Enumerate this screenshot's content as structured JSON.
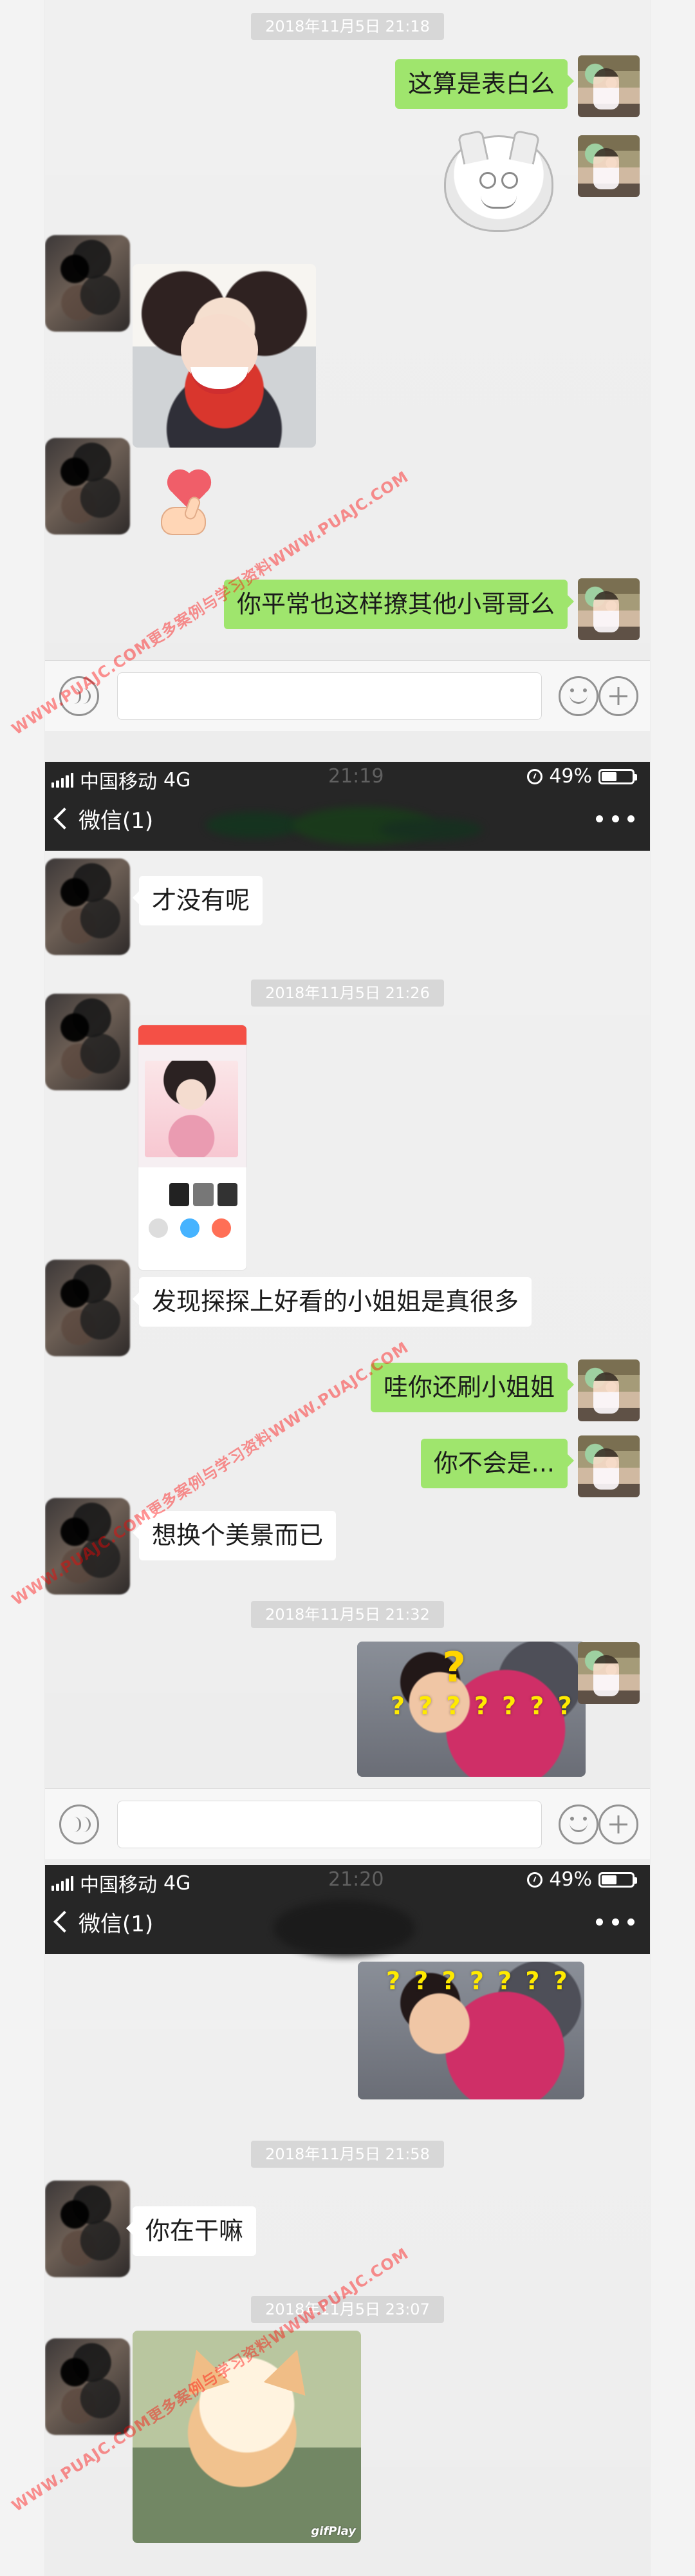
{
  "colors": {
    "accent_green": "#9fe56d",
    "nav_bg": "#262626",
    "chat_bg": "#ededed",
    "timestamp_bg": "#d7d7d7",
    "watermark_red": "rgba(255,0,0,0.42)"
  },
  "watermark_text": "WWW.PUAJC.COM更多案例与学习资料WWW.PUAJC.COM",
  "segments": [
    {
      "timestamps": [
        "2018年11月5日 21:18"
      ],
      "messages": [
        {
          "text": "这算是表白么"
        },
        {
          "text": "你平常也这样撩其他小哥哥么"
        }
      ]
    },
    {
      "status": {
        "carrier": "中国移动",
        "network": "4G",
        "time": "21:19",
        "battery": "49%"
      },
      "title": "微信(1)",
      "timestamps": [
        "2018年11月5日 21:26",
        "2018年11月5日 21:32"
      ],
      "messages": [
        {
          "text": "才没有呢"
        },
        {
          "text": "发现探探上好看的小姐姐是真很多"
        },
        {
          "text": "哇你还刷小姐姐"
        },
        {
          "text": "你不会是..."
        },
        {
          "text": "想换个美景而已"
        }
      ],
      "question_overlay": "? ? ? ? ? ? ?"
    },
    {
      "status": {
        "carrier": "中国移动",
        "network": "4G",
        "time": "21:20",
        "battery": "49%"
      },
      "title": "微信(1)",
      "timestamps": [
        "2018年11月5日 21:58",
        "2018年11月5日 23:07"
      ],
      "messages": [
        {
          "text": "你在干嘛"
        }
      ],
      "question_overlay": "? ? ? ? ? ? ?",
      "sticker_brand": "gifPlay"
    }
  ],
  "icons": {
    "voice": "voice-icon",
    "emoji": "emoji-icon",
    "plus": "plus-icon",
    "back": "chevron-left-icon",
    "more": "more-icon",
    "alarm": "alarm-icon",
    "battery": "battery-icon",
    "signal": "signal-icon"
  }
}
